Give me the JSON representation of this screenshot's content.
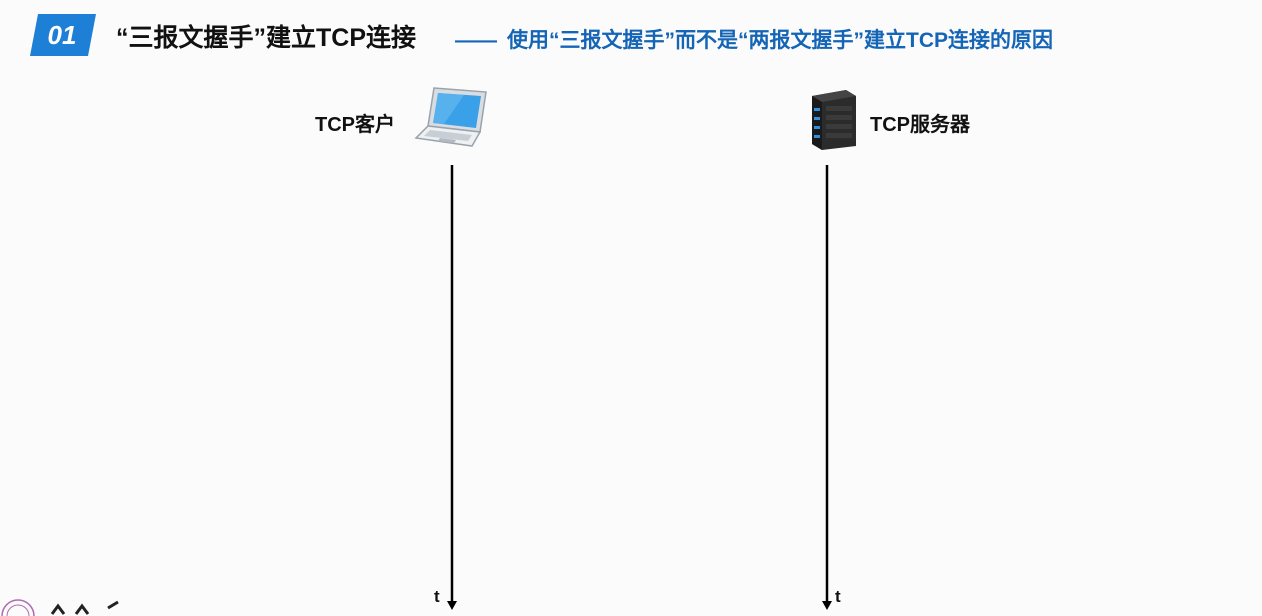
{
  "header": {
    "badge_number": "01",
    "title": "“三报文握手”建立TCP连接",
    "subtitle_dash": "——",
    "subtitle": "使用“三报文握手”而不是“两报文握手”建立TCP连接的原因"
  },
  "diagram": {
    "client": {
      "label": "TCP客户",
      "icon": "laptop-icon"
    },
    "server": {
      "label": "TCP服务器",
      "icon": "server-icon"
    },
    "client_time_label": "t",
    "server_time_label": "t"
  },
  "colors": {
    "accent": "#1e7fd6",
    "subtitle": "#1565b6",
    "line": "#000000"
  }
}
